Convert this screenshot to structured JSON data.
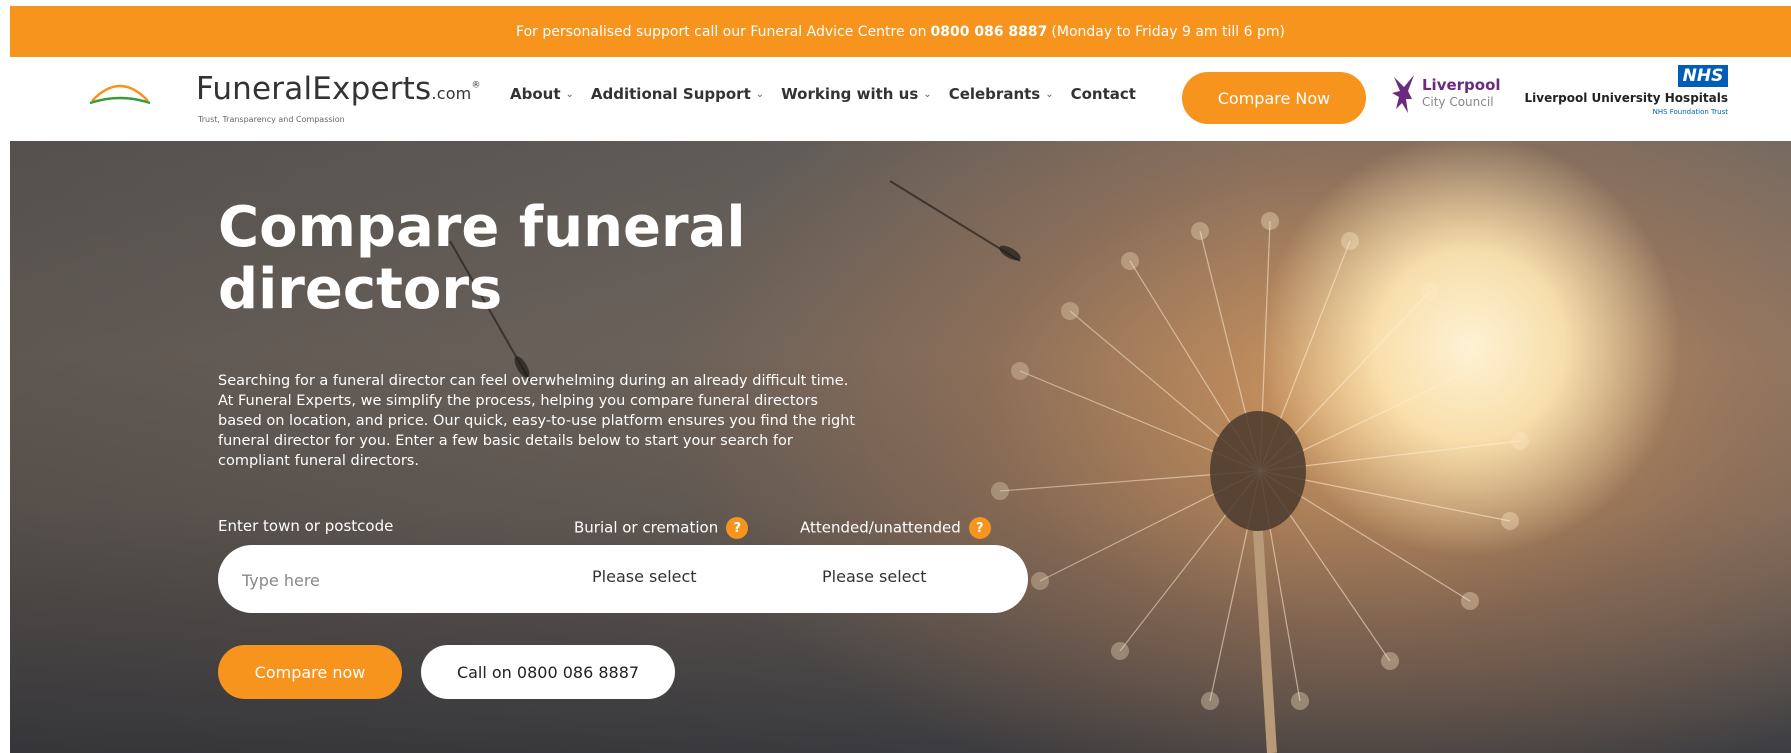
{
  "topbar": {
    "text_before": "For personalised support call our Funeral Advice Centre on",
    "phone": "0800 086 8887",
    "text_after": "(Monday to Friday 9 am till 6 pm)"
  },
  "logo": {
    "name": "FuneralExperts",
    "suffix": ".com",
    "registered": "®",
    "tagline": "Trust, Transparency and Compassion"
  },
  "nav": {
    "items": [
      {
        "label": "About",
        "has_dropdown": true
      },
      {
        "label": "Additional Support",
        "has_dropdown": true
      },
      {
        "label": "Working with us",
        "has_dropdown": true
      },
      {
        "label": "Celebrants",
        "has_dropdown": true
      },
      {
        "label": "Contact",
        "has_dropdown": false
      }
    ],
    "cta": "Compare Now"
  },
  "partners": {
    "council_line1": "Liverpool",
    "council_line2": "City Council",
    "nhs_badge": "NHS",
    "nhs_line1": "Liverpool University Hospitals",
    "nhs_line2": "NHS Foundation Trust"
  },
  "hero": {
    "title": "Compare funeral directors",
    "description": "Searching for a funeral director can feel overwhelming during an already difficult time. At Funeral Experts, we simplify the process, helping you compare funeral directors based on location, and price. Our quick, easy-to-use platform ensures you find the right funeral director for you. Enter a few basic details below to start your search for compliant funeral directors.",
    "form": {
      "label_location": "Enter town or postcode",
      "label_burial": "Burial or cremation",
      "label_attended": "Attended/unattended",
      "help_glyph": "?",
      "location_placeholder": "Type here",
      "burial_value": "Please select",
      "attended_value": "Please select"
    },
    "buttons": {
      "compare": "Compare now",
      "call": "Call on 0800 086 8887"
    }
  },
  "colors": {
    "accent": "#f7941d",
    "nhs_blue": "#005eb8",
    "council_purple": "#6b2a7e"
  }
}
